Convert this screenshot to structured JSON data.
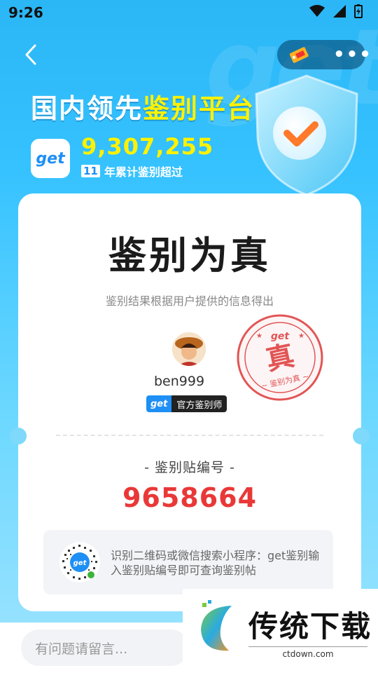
{
  "status_bar": {
    "time": "9:26"
  },
  "nav": {
    "back_icon": "chevron-left-icon",
    "tag_icon": "tag-label-icon",
    "more_icon": "more-dots-icon",
    "more_text": "•••"
  },
  "header": {
    "headline_prefix": "国内领先",
    "headline_highlight": "鉴别平台",
    "logo_text": "get",
    "stat_number": "9,307,255",
    "stat_years": "11",
    "stat_caption": "年累计鉴别超过"
  },
  "card": {
    "title": "鉴别为真",
    "subtitle": "鉴别结果根据用户提供的信息得出",
    "appraiser": {
      "username": "ben999",
      "badge_logo": "get",
      "badge_text": "官方鉴别师"
    },
    "stamp": {
      "brand": "get",
      "char": "真",
      "caption": "~ 鉴别为真 ~"
    },
    "code_label": "- 鉴别贴编号 -",
    "code_value": "9658664",
    "qr_hint": "识别二维码或微信搜索小程序：get鉴别输入鉴别贴编号即可查询鉴别帖"
  },
  "bottom": {
    "comment_placeholder": "有问题请留言..."
  },
  "watermark": {
    "title": "传统下载",
    "url": "ctdown.com"
  },
  "colors": {
    "accent_blue": "#1e8ff5",
    "highlight_yellow": "#fff200",
    "code_red": "#e93838",
    "stamp_red": "#e25555"
  }
}
